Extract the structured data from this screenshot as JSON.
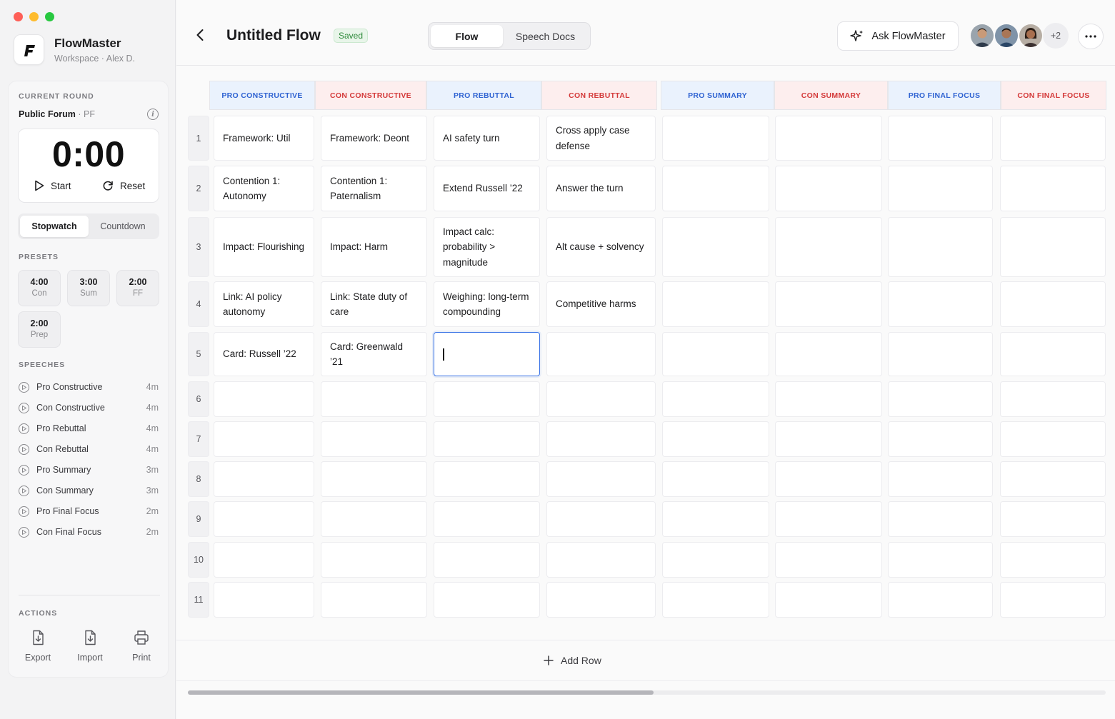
{
  "app": {
    "name": "FlowMaster",
    "workspace": "Workspace",
    "user": "Alex D."
  },
  "current_round": {
    "section_label": "CURRENT ROUND",
    "event": "Public Forum",
    "format": "PF"
  },
  "timer": {
    "value": "0:00",
    "start_label": "Start",
    "reset_label": "Reset",
    "modes": [
      "Stopwatch",
      "Countdown"
    ],
    "active_mode": "Stopwatch"
  },
  "presets": {
    "label": "PRESETS",
    "items": [
      {
        "time": "4:00",
        "label": "Con"
      },
      {
        "time": "3:00",
        "label": "Sum"
      },
      {
        "time": "2:00",
        "label": "FF"
      },
      {
        "time": "2:00",
        "label": "Prep"
      }
    ]
  },
  "speeches": {
    "label": "SPEECHES",
    "items": [
      {
        "name": "Pro Constructive",
        "duration": "4m"
      },
      {
        "name": "Con Constructive",
        "duration": "4m"
      },
      {
        "name": "Pro Rebuttal",
        "duration": "4m"
      },
      {
        "name": "Con Rebuttal",
        "duration": "4m"
      },
      {
        "name": "Pro Summary",
        "duration": "3m"
      },
      {
        "name": "Con Summary",
        "duration": "3m"
      },
      {
        "name": "Pro Final Focus",
        "duration": "2m"
      },
      {
        "name": "Con Final Focus",
        "duration": "2m"
      }
    ]
  },
  "actions": {
    "label": "ACTIONS",
    "export": "Export",
    "import": "Import",
    "print": "Print"
  },
  "header": {
    "title": "Untitled Flow",
    "status": "Saved",
    "tabs": [
      "Flow",
      "Speech Docs"
    ],
    "active_tab": "Flow",
    "ask_label": "Ask FlowMaster",
    "extra_collaborators": "+2"
  },
  "grid": {
    "columns": [
      {
        "label": "PRO CONSTRUCTIVE",
        "side": "pro"
      },
      {
        "label": "CON CONSTRUCTIVE",
        "side": "con"
      },
      {
        "label": "PRO REBUTTAL",
        "side": "pro"
      },
      {
        "label": "CON REBUTTAL",
        "side": "con"
      },
      {
        "label": "PRO SUMMARY",
        "side": "pro"
      },
      {
        "label": "CON SUMMARY",
        "side": "con"
      },
      {
        "label": "PRO FINAL FOCUS",
        "side": "pro"
      },
      {
        "label": "CON FINAL FOCUS",
        "side": "con"
      }
    ],
    "row_numbers": [
      "1",
      "2",
      "3",
      "4",
      "5",
      "6",
      "7",
      "8",
      "9",
      "10",
      "11"
    ],
    "rows": [
      [
        "Framework: Util",
        "Framework: Deont",
        "AI safety turn",
        "Cross apply case defense",
        "",
        "",
        "",
        ""
      ],
      [
        "Contention 1: Autonomy",
        "Contention 1: Paternalism",
        "Extend Russell ’22",
        "Answer the turn",
        "",
        "",
        "",
        ""
      ],
      [
        "Impact: Flourishing",
        "Impact: Harm",
        "Impact calc: probability > magnitude",
        "Alt cause + solvency",
        "",
        "",
        "",
        ""
      ],
      [
        "Link: AI policy autonomy",
        "Link: State duty of care",
        "Weighing: long-term compounding",
        "Competitive harms",
        "",
        "",
        "",
        ""
      ],
      [
        "Card: Russell ’22",
        "Card: Greenwald ’21",
        "",
        "",
        "",
        "",
        "",
        ""
      ],
      [
        "",
        "",
        "",
        "",
        "",
        "",
        "",
        ""
      ],
      [
        "",
        "",
        "",
        "",
        "",
        "",
        "",
        ""
      ],
      [
        "",
        "",
        "",
        "",
        "",
        "",
        "",
        ""
      ],
      [
        "",
        "",
        "",
        "",
        "",
        "",
        "",
        ""
      ],
      [
        "",
        "",
        "",
        "",
        "",
        "",
        "",
        ""
      ],
      [
        "",
        "",
        "",
        "",
        "",
        "",
        "",
        ""
      ]
    ],
    "active_cell": {
      "row": 5,
      "column": 3
    },
    "add_row_label": "Add Row"
  },
  "colors": {
    "pro_text": "#2f63d2",
    "pro_bg": "#eaf2fd",
    "con_text": "#d43a3a",
    "con_bg": "#fdeeee",
    "accent": "#3b74e6",
    "saved_green": "#2f8a3b"
  },
  "icons": {
    "back": "chevron-left-icon",
    "ask": "sparkle-icon",
    "more": "ellipsis-icon",
    "add_row": "plus-icon",
    "start": "play-icon",
    "reset": "refresh-icon",
    "info": "info-icon",
    "export": "export-file-icon",
    "import": "import-file-icon",
    "print": "printer-icon"
  }
}
